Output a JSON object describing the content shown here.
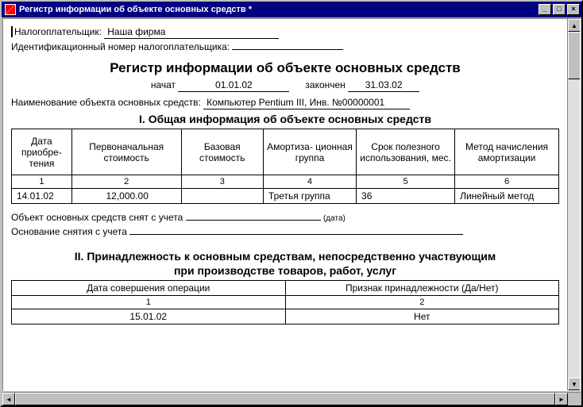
{
  "window": {
    "title": "Регистр информации об объекте основных средств  *"
  },
  "fields": {
    "taxpayer_label": "Налогоплательщик:",
    "taxpayer_value": "Наша фирма",
    "tin_label": "Идентификационный номер налогоплательщика:",
    "tin_value": "",
    "doc_title": "Регистр информации об объекте основных средств",
    "started_label": "начат",
    "started_value": "01.01.02",
    "finished_label": "закончен",
    "finished_value": "31.03.02",
    "object_label": "Наименование объекта основных средств:",
    "object_value": "Компьютер Pentium III, Инв. №00000001"
  },
  "section1": {
    "title": "I. Общая информация об объекте основных средств",
    "headers": [
      "Дата приобре-\nтения",
      "Первоначальная стоимость",
      "Базовая стоимость",
      "Амортиза-\nционная группа",
      "Срок полезного использования, мес.",
      "Метод начисления амортизации"
    ],
    "nums": [
      "1",
      "2",
      "3",
      "4",
      "5",
      "6"
    ],
    "row": [
      "14.01.02",
      "12,000.00",
      "",
      "Третья группа",
      "36",
      "Линейный метод"
    ]
  },
  "removal": {
    "label": "Объект основных средств снят с учета",
    "date_hint": "(дата)",
    "basis_label": "Основание снятия с учета"
  },
  "section2": {
    "title_l1": "II. Принадлежность к основным средствам, непосредственно участвующим",
    "title_l2": "при производстве товаров, работ, услуг",
    "headers": [
      "Дата совершения операции",
      "Признак принадлежности (Да/Нет)"
    ],
    "nums": [
      "1",
      "2"
    ],
    "row": [
      "15.01.02",
      "Нет"
    ]
  }
}
